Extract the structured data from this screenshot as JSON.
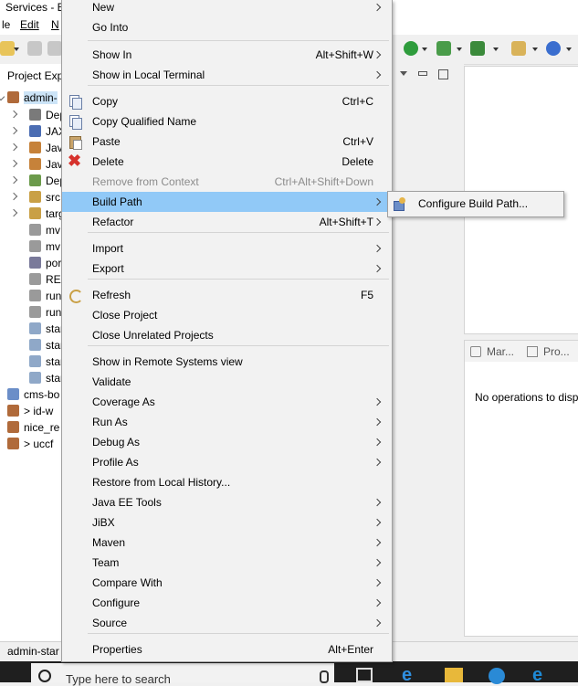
{
  "window": {
    "title": "Services - E"
  },
  "menubar": {
    "items": [
      "le",
      "Edit",
      "N"
    ]
  },
  "explorer": {
    "title": "Project Exp",
    "rows": [
      "admin-",
      "Dep",
      "JAX",
      "Jav",
      "Jav",
      "Dep",
      "src",
      "targ",
      "mv",
      "mv",
      "por",
      "REA",
      "run",
      "run",
      "star",
      "star",
      "star",
      "star",
      "cms-bo",
      "> id-w",
      "nice_re",
      "> uccf"
    ]
  },
  "right_panel": {
    "tabs": [
      "Mar...",
      "Pro..."
    ],
    "message": "No operations to disp"
  },
  "status_bar": {
    "text": "admin-star"
  },
  "taskbar": {
    "search_placeholder": "Type here to search"
  },
  "context_menu": {
    "items": [
      {
        "label": "New",
        "accel": "",
        "submenu": true
      },
      {
        "label": "Go Into",
        "accel": "",
        "submenu": false
      },
      {
        "label": "Show In",
        "accel": "Alt+Shift+W",
        "submenu": true
      },
      {
        "label": "Show in Local Terminal",
        "accel": "",
        "submenu": true
      },
      {
        "label": "Copy",
        "accel": "Ctrl+C",
        "submenu": false,
        "icon": "copy-icon"
      },
      {
        "label": "Copy Qualified Name",
        "accel": "",
        "submenu": false,
        "icon": "copy-qualified-icon"
      },
      {
        "label": "Paste",
        "accel": "Ctrl+V",
        "submenu": false,
        "icon": "paste-icon"
      },
      {
        "label": "Delete",
        "accel": "Delete",
        "submenu": false,
        "icon": "delete-icon"
      },
      {
        "label": "Remove from Context",
        "accel": "Ctrl+Alt+Shift+Down",
        "submenu": false,
        "disabled": true,
        "icon": "remove-context-icon"
      },
      {
        "label": "Build Path",
        "accel": "",
        "submenu": true,
        "highlighted": true
      },
      {
        "label": "Refactor",
        "accel": "Alt+Shift+T",
        "submenu": true
      },
      {
        "label": "Import",
        "accel": "",
        "submenu": true
      },
      {
        "label": "Export",
        "accel": "",
        "submenu": true
      },
      {
        "label": "Refresh",
        "accel": "F5",
        "submenu": false,
        "icon": "refresh-icon"
      },
      {
        "label": "Close Project",
        "accel": "",
        "submenu": false
      },
      {
        "label": "Close Unrelated Projects",
        "accel": "",
        "submenu": false
      },
      {
        "label": "Show in Remote Systems view",
        "accel": "",
        "submenu": false
      },
      {
        "label": "Validate",
        "accel": "",
        "submenu": false
      },
      {
        "label": "Coverage As",
        "accel": "",
        "submenu": true
      },
      {
        "label": "Run As",
        "accel": "",
        "submenu": true
      },
      {
        "label": "Debug As",
        "accel": "",
        "submenu": true
      },
      {
        "label": "Profile As",
        "accel": "",
        "submenu": true
      },
      {
        "label": "Restore from Local History...",
        "accel": "",
        "submenu": false
      },
      {
        "label": "Java EE Tools",
        "accel": "",
        "submenu": true
      },
      {
        "label": "JiBX",
        "accel": "",
        "submenu": true
      },
      {
        "label": "Maven",
        "accel": "",
        "submenu": true
      },
      {
        "label": "Team",
        "accel": "",
        "submenu": true
      },
      {
        "label": "Compare With",
        "accel": "",
        "submenu": true
      },
      {
        "label": "Configure",
        "accel": "",
        "submenu": true
      },
      {
        "label": "Source",
        "accel": "",
        "submenu": true
      },
      {
        "label": "Properties",
        "accel": "Alt+Enter",
        "submenu": false
      }
    ]
  },
  "submenu": {
    "label": "Configure Build Path...",
    "icon": "build-path-icon"
  },
  "colors": {
    "highlight": "#91c9f7",
    "menu_bg": "#f2f2f2",
    "taskbar": "#1f1f1f"
  }
}
